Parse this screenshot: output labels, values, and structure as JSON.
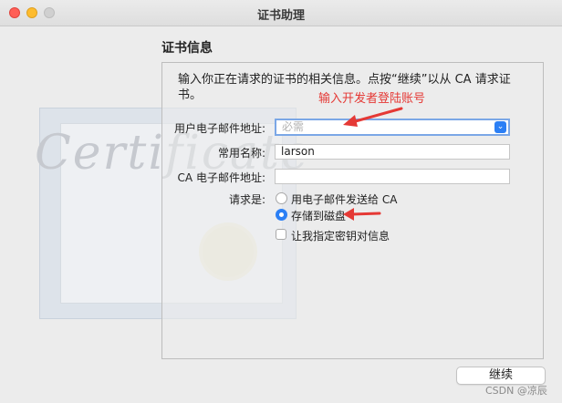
{
  "window": {
    "title": "证书助理"
  },
  "section_title": "证书信息",
  "intro": "输入你正在请求的证书的相关信息。点按“继续”以从 CA 请求证书。",
  "annotations": {
    "email_hint": "输入开发者登陆账号",
    "color": "#e53935"
  },
  "cert_art": {
    "word": "Certificate"
  },
  "form": {
    "email": {
      "label": "用户电子邮件地址:",
      "value": "",
      "placeholder": "必需"
    },
    "common_name": {
      "label": "常用名称:",
      "value": "larson"
    },
    "ca_email": {
      "label": "CA 电子邮件地址:",
      "value": ""
    },
    "request_label": "请求是:",
    "options": [
      {
        "label": "用电子邮件发送给 CA",
        "selected": false
      },
      {
        "label": "存储到磁盘",
        "selected": true
      }
    ],
    "key_pair": {
      "label": "让我指定密钥对信息",
      "checked": false
    }
  },
  "buttons": {
    "continue": "继续"
  },
  "watermark": "CSDN @凉辰",
  "colors": {
    "accent": "#2b7ff5",
    "arrow": "#e53935"
  }
}
